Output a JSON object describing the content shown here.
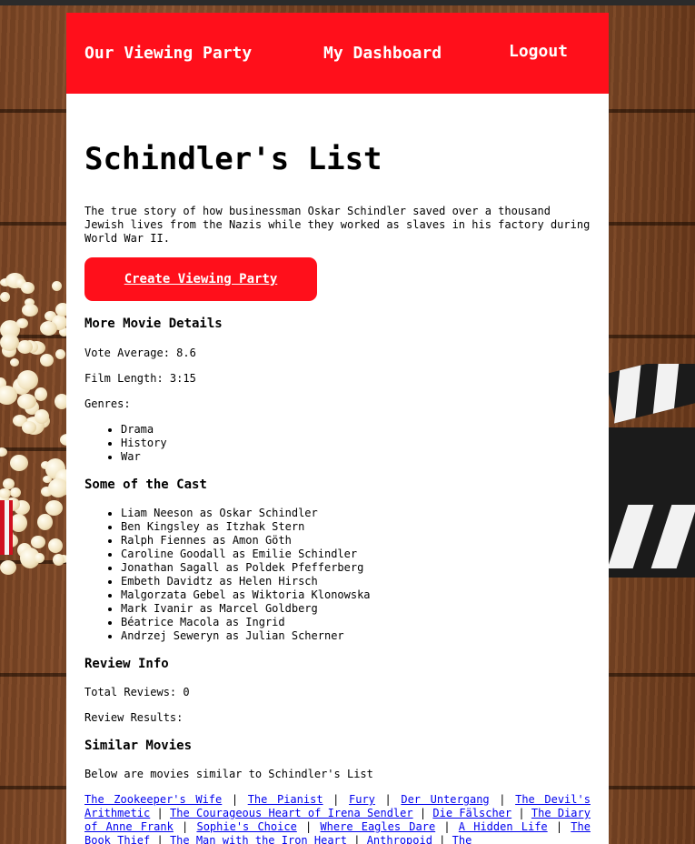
{
  "nav": {
    "home": "Our Viewing Party",
    "dashboard": "My Dashboard",
    "logout": "Logout"
  },
  "movie": {
    "title": "Schindler's List",
    "overview": "The true story of how businessman Oskar Schindler saved over a thousand Jewish lives from the Nazis while they worked as slaves in his factory during World War II.",
    "cta": "Create Viewing Party"
  },
  "details": {
    "heading": "More Movie Details",
    "vote": "Vote Average: 8.6",
    "length": "Film Length: 3:15",
    "genres_label": "Genres:",
    "genres": [
      "Drama",
      "History",
      "War"
    ]
  },
  "cast": {
    "heading": "Some of the Cast",
    "members": [
      "Liam Neeson as Oskar Schindler",
      "Ben Kingsley as Itzhak Stern",
      "Ralph Fiennes as Amon Göth",
      "Caroline Goodall as Emilie Schindler",
      "Jonathan Sagall as Poldek Pfefferberg",
      "Embeth Davidtz as Helen Hirsch",
      "Malgorzata Gebel as Wiktoria Klonowska",
      "Mark Ivanir as Marcel Goldberg",
      "Béatrice Macola as Ingrid",
      "Andrzej Seweryn as Julian Scherner"
    ]
  },
  "reviews": {
    "heading": "Review Info",
    "total": "Total Reviews: 0",
    "results": "Review Results:"
  },
  "similar": {
    "heading": "Similar Movies",
    "intro": "Below are movies similar to Schindler's List",
    "separator": " | ",
    "movies": [
      "The Zookeeper's Wife",
      "The Pianist",
      "Fury",
      "Der Untergang",
      "The Devil's Arithmetic",
      "The Courageous Heart of Irena Sendler",
      "Die Fälscher",
      "The Diary of Anne Frank",
      "Sophie's Choice",
      "Where Eagles Dare",
      "A Hidden Life",
      "The Book Thief",
      "The Man with the Iron Heart",
      "Anthropoid",
      "The"
    ]
  },
  "colors": {
    "brand_red": "#ff0f1b",
    "link_blue": "#0000ee"
  }
}
